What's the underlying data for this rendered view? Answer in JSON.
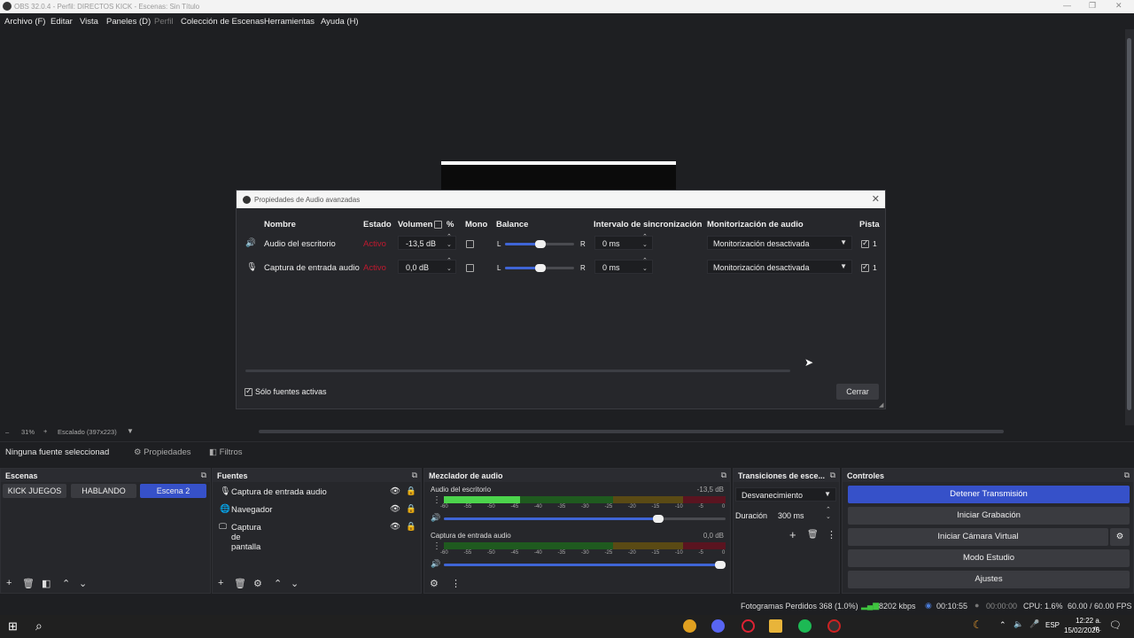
{
  "window": {
    "title": "OBS 32.0.4 - Perfil: DIRECTOS KICK - Escenas: Sin Título"
  },
  "menu": [
    "Archivo (F)",
    "Editar",
    "Vista",
    "Paneles (D)",
    "Perfil",
    "Colección de Escenas",
    "Herramientas",
    "Ayuda (H)"
  ],
  "zoom": {
    "percent": "31%",
    "plus": "+",
    "scaled": "Escalado (397x223)"
  },
  "source_toolbar": {
    "status": "Ninguna fuente seleccionad",
    "properties": "Propiedades",
    "filters": "Filtros"
  },
  "dialog": {
    "title": "Propiedades de Audio avanzadas",
    "headers": {
      "name": "Nombre",
      "state": "Estado",
      "volume": "Volumen",
      "percent": "%",
      "mono": "Mono",
      "balance": "Balance",
      "sync": "Intervalo de sincronización",
      "monitor": "Monitorización de audio",
      "track": "Pista"
    },
    "rows": [
      {
        "name": "Audio del escritorio",
        "state": "Activo",
        "volume": "-13,5 dB",
        "balance_left": "L",
        "balance_right": "R",
        "sync": "0 ms",
        "monitor": "Monitorización desactivada",
        "track": "1",
        "icon": "speaker-icon"
      },
      {
        "name": "Captura de entrada audio",
        "state": "Activo",
        "volume": "0,0 dB",
        "balance_left": "L",
        "balance_right": "R",
        "sync": "0 ms",
        "monitor": "Monitorización desactivada",
        "track": "1",
        "icon": "microphone-icon"
      }
    ],
    "active_only": "Sólo fuentes activas",
    "close": "Cerrar"
  },
  "docks": {
    "scenes": {
      "title": "Escenas",
      "items": [
        "KICK JUEGOS",
        "HABLANDO",
        "Escena 2"
      ],
      "active": "Escena 2"
    },
    "sources": {
      "title": "Fuentes",
      "items": [
        {
          "label": "Captura de entrada audio",
          "icon": "microphone-icon"
        },
        {
          "label": "Navegador",
          "icon": "globe-icon"
        },
        {
          "label": "Captura de pantalla",
          "icon": "monitor-icon"
        }
      ]
    },
    "mixer": {
      "title": "Mezclador de audio",
      "channels": [
        {
          "name": "Audio del escritorio",
          "db": "-13,5 dB",
          "level": 0.27,
          "volume": 0.78
        },
        {
          "name": "Captura de entrada audio",
          "db": "0,0 dB",
          "level": 0.0,
          "volume": 1.0
        }
      ],
      "ticks": [
        "-60",
        "-55",
        "-50",
        "-45",
        "-40",
        "-35",
        "-30",
        "-25",
        "-20",
        "-15",
        "-10",
        "-5",
        "0"
      ]
    },
    "transitions": {
      "title": "Transiciones de esce...",
      "type": "Desvanecimiento",
      "duration_label": "Duración",
      "duration": "300 ms"
    },
    "controls": {
      "title": "Controles",
      "buttons": [
        "Detener Transmisión",
        "Iniciar Grabación",
        "Iniciar Cámara Virtual",
        "Modo Estudio",
        "Ajustes"
      ]
    }
  },
  "status": {
    "dropped": "Fotogramas Perdidos 368 (1.0%)",
    "kbps": "8202 kbps",
    "stream_time": "00:10:55",
    "rec_time": "00:00:00",
    "cpu": "CPU: 1.6%",
    "fps": "60.00 / 60.00 FPS"
  },
  "taskbar": {
    "lang": "ESP",
    "time": "12:22 a. m.",
    "date": "15/02/2026"
  }
}
